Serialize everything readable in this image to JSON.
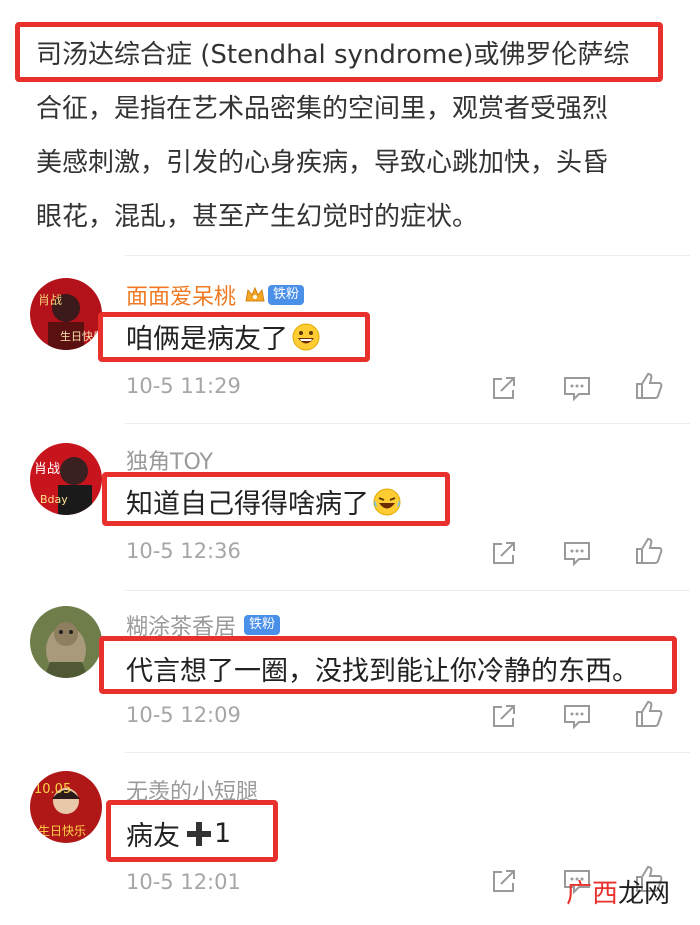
{
  "intro": {
    "lines": [
      "司汤达综合症 (Stendhal syndrome)或佛罗伦萨综",
      "合征，是指在艺术品密集的空间里，观赏者受强烈",
      "美感刺激，引发的心身疾病，导致心跳加快，头昏",
      "眼花，混乱，甚至产生幻觉时的症状。"
    ]
  },
  "comments": [
    {
      "username": "面面爱呆桃",
      "badge": "铁粉",
      "vip": true,
      "text": "咱俩是病友了",
      "emoji": "grinning-emoji",
      "time": "10-5 11:29"
    },
    {
      "username": "独角TOY",
      "badge": "",
      "vip": false,
      "text": "知道自己得得啥病了",
      "emoji": "laughing-tears-emoji",
      "time": "10-5 12:36"
    },
    {
      "username": "糊涂茶香居",
      "badge": "铁粉",
      "vip": false,
      "text": "代言想了一圈，没找到能让你冷静的东西。",
      "emoji": "",
      "time": "10-5 12:09"
    },
    {
      "username": "无羡的小短腿",
      "badge": "",
      "vip": false,
      "text": "病友",
      "suffix": "1",
      "emoji": "plus-sign",
      "time": "10-5 12:01"
    }
  ],
  "actions": [
    "share-icon",
    "comment-icon",
    "like-icon"
  ],
  "watermark": {
    "part1": "广西",
    "part2": "龙网"
  },
  "colors": {
    "highlight": "#e8302c",
    "vip_name": "#f07a23",
    "fan_badge": "#4a8fe8",
    "muted": "#9a9a9a"
  }
}
